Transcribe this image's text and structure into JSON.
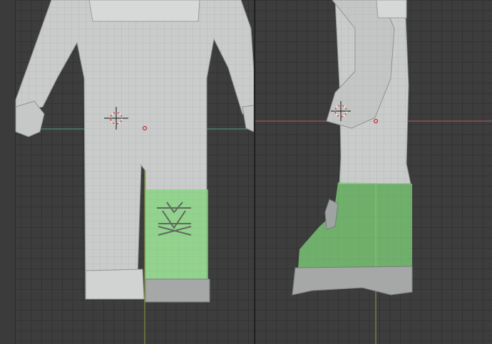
{
  "viewports": [
    {
      "id": "front",
      "view": "front-orthographic",
      "selected_part": "boot"
    },
    {
      "id": "side",
      "view": "side-orthographic",
      "selected_part": "boot"
    }
  ],
  "colors": {
    "background": "#3d3d3d",
    "grid_line": "#333333",
    "mesh": "#c9cccb",
    "mesh_wire": "#9fa3a2",
    "selection": "#7fd67a",
    "x_axis": "#b35a5f",
    "y_axis": "#4f9f7a",
    "z_axis": "#8fa33b"
  },
  "icons": [
    "3d-cursor-icon",
    "object-origin-icon"
  ]
}
